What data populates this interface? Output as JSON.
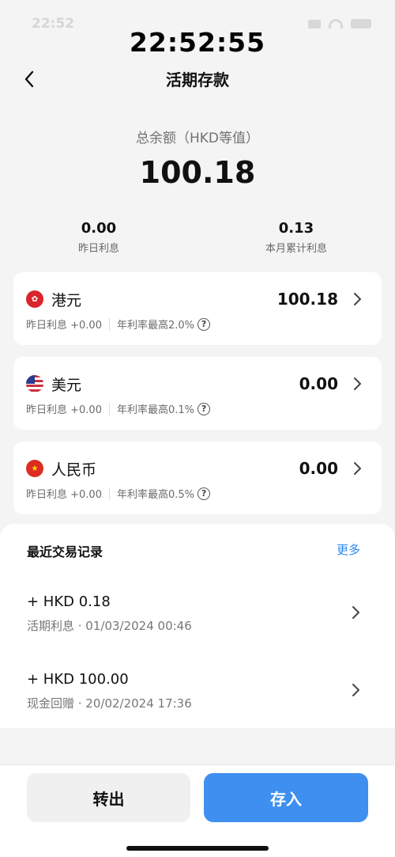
{
  "status_bar": {
    "time": "22:52"
  },
  "overlay_clock": "22:52:55",
  "nav": {
    "title": "活期存款"
  },
  "balance": {
    "label": "总余额（HKD等值）",
    "value": "100.18"
  },
  "interest": {
    "yesterday": {
      "value": "0.00",
      "label": "昨日利息"
    },
    "month": {
      "value": "0.13",
      "label": "本月累计利息"
    }
  },
  "currencies": [
    {
      "name": "港元",
      "amount": "100.18",
      "yesterday": "昨日利息 +0.00",
      "rate": "年利率最高2.0%"
    },
    {
      "name": "美元",
      "amount": "0.00",
      "yesterday": "昨日利息 +0.00",
      "rate": "年利率最高0.1%"
    },
    {
      "name": "人民币",
      "amount": "0.00",
      "yesterday": "昨日利息 +0.00",
      "rate": "年利率最高0.5%"
    }
  ],
  "records": {
    "title": "最近交易记录",
    "more": "更多",
    "items": [
      {
        "amount": "+ HKD 0.18",
        "desc": "活期利息 · 01/03/2024 00:46"
      },
      {
        "amount": "+ HKD 100.00",
        "desc": "现金回赠 · 20/02/2024 17:36"
      }
    ]
  },
  "actions": {
    "transfer_out": "转出",
    "deposit": "存入"
  },
  "colors": {
    "accent": "#3f8ff0",
    "background": "#f4f4f4"
  }
}
